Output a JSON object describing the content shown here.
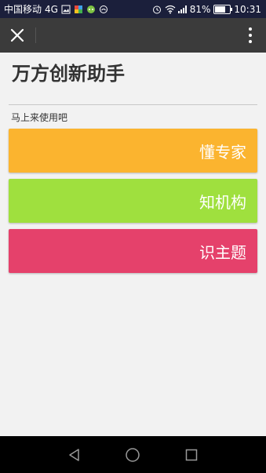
{
  "status_bar": {
    "carrier": "中国移动",
    "network": "4G",
    "battery_percent": "81%",
    "battery_level": 0.81,
    "time": "10:31",
    "icons": [
      "image-icon",
      "app-icon",
      "chat-icon",
      "shield-icon",
      "alarm-icon",
      "wifi-icon",
      "signal-icon",
      "battery-icon"
    ]
  },
  "app_bar": {
    "close_icon": "close-icon",
    "more_icon": "more-vert-icon"
  },
  "main": {
    "title": "万方创新助手",
    "subtitle": "马上来使用吧",
    "cards": [
      {
        "label": "懂专家",
        "color": "#fbb42f"
      },
      {
        "label": "知机构",
        "color": "#9fe03e"
      },
      {
        "label": "识主题",
        "color": "#e5416b"
      }
    ]
  },
  "nav_bar": {
    "icons": [
      "back-icon",
      "home-icon",
      "recent-apps-icon"
    ]
  },
  "colors": {
    "status_bar": "#1b1f3b",
    "app_bar": "#3b3b3b",
    "background": "#f2f2f2"
  }
}
